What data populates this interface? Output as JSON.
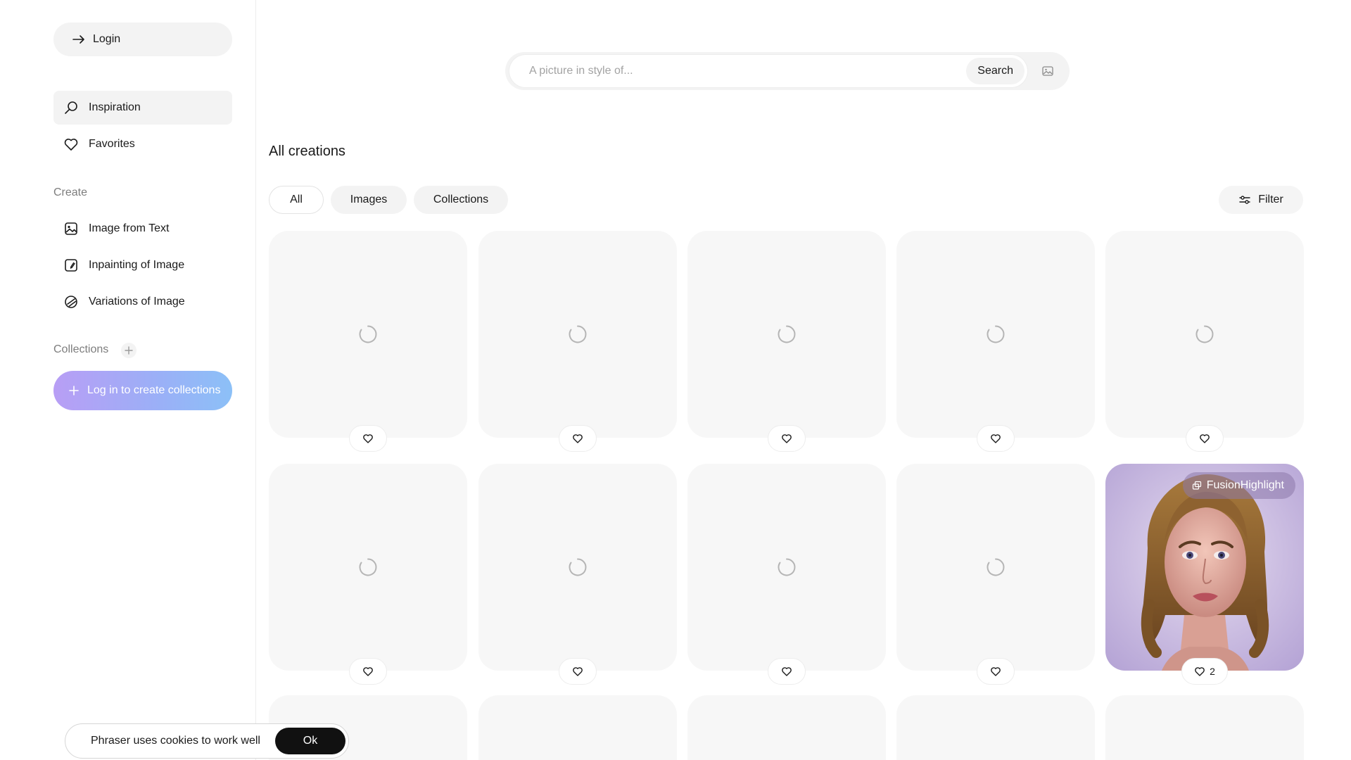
{
  "sidebar": {
    "login_label": "Login",
    "nav": [
      {
        "label": "Inspiration",
        "icon": "search-icon",
        "active": true
      },
      {
        "label": "Favorites",
        "icon": "heart-icon",
        "active": false
      }
    ],
    "create_label": "Create",
    "create_items": [
      {
        "label": "Image from Text",
        "icon": "image-icon"
      },
      {
        "label": "Inpainting of Image",
        "icon": "inpaint-icon"
      },
      {
        "label": "Variations of Image",
        "icon": "variations-icon"
      }
    ],
    "collections_label": "Collections",
    "collections_cta": "Log in to create collections"
  },
  "search": {
    "placeholder": "A picture in style of...",
    "value": "",
    "button_label": "Search"
  },
  "main": {
    "heading": "All creations",
    "tabs": [
      {
        "label": "All",
        "active": true
      },
      {
        "label": "Images",
        "active": false
      },
      {
        "label": "Collections",
        "active": false
      }
    ],
    "filter_label": "Filter",
    "featured": {
      "badge_label": "FusionHighlight",
      "likes": "2"
    }
  },
  "cookie": {
    "message": "Phraser uses cookies to work well",
    "ok_label": "Ok"
  },
  "colors": {
    "accent_gradient_start": "#b89ef5",
    "accent_gradient_end": "#8cc0f7",
    "card_bg": "#f7f7f7",
    "ok_bg": "#111111"
  }
}
